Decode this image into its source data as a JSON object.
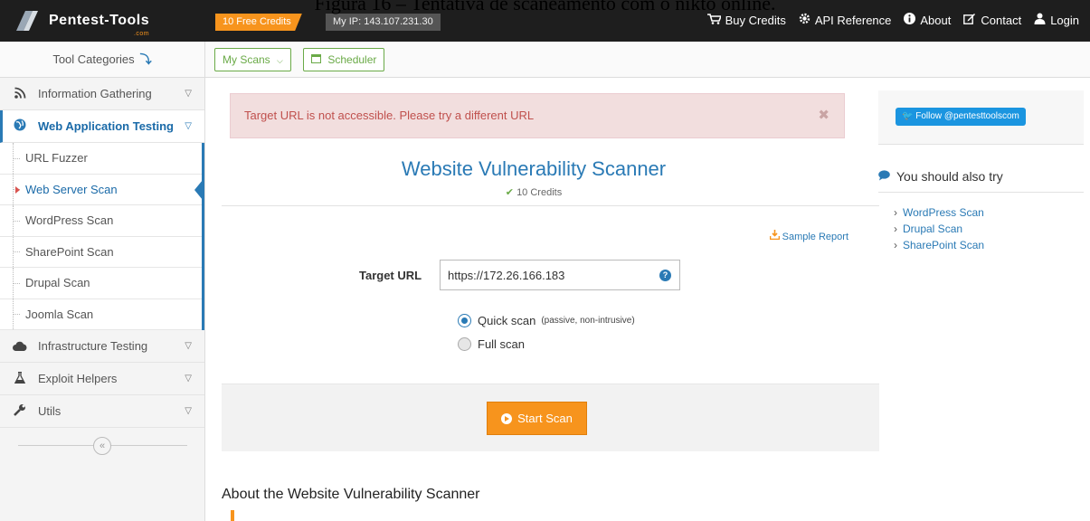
{
  "caption": "Figura 16 – Tentativa de scaneamento com o nikto online.",
  "header": {
    "logo_text": "Pentest-Tools",
    "logo_sub": ".com",
    "credits": "10 Free Credits",
    "my_ip": "My IP: 143.107.231.30",
    "nav": [
      {
        "icon": "cart-icon",
        "label": "Buy Credits"
      },
      {
        "icon": "gear-icon",
        "label": "API Reference"
      },
      {
        "icon": "info-icon",
        "label": "About"
      },
      {
        "icon": "edit-icon",
        "label": "Contact"
      },
      {
        "icon": "user-icon",
        "label": "Login"
      }
    ]
  },
  "toolbar": {
    "tool_categories": "Tool Categories",
    "my_scans": "My Scans",
    "scheduler": "Scheduler"
  },
  "sidebar": {
    "categories": [
      {
        "icon": "rss-icon",
        "label": "Information Gathering"
      },
      {
        "icon": "globe-icon",
        "label": "Web Application Testing",
        "active": true
      },
      {
        "icon": "cloud-icon",
        "label": "Infrastructure Testing"
      },
      {
        "icon": "flask-icon",
        "label": "Exploit Helpers"
      },
      {
        "icon": "wrench-icon",
        "label": "Utils"
      }
    ],
    "sub_items": [
      "URL Fuzzer",
      "Web Server Scan",
      "WordPress Scan",
      "SharePoint Scan",
      "Drupal Scan",
      "Joomla Scan"
    ],
    "active_sub": "Web Server Scan"
  },
  "main": {
    "alert": "Target URL is not accessible. Please try a different URL",
    "title": "Website Vulnerability Scanner",
    "credits": "10 Credits",
    "sample_report": "Sample Report",
    "target_label": "Target URL",
    "target_value": "https://172.26.166.183",
    "quick_scan": "Quick scan",
    "quick_hint": "(passive, non-intrusive)",
    "full_scan": "Full scan",
    "start_scan": "Start Scan",
    "about_heading": "About the Website Vulnerability Scanner"
  },
  "right": {
    "follow": "Follow @pentesttoolscom",
    "also_try": "You should also try",
    "links": [
      "WordPress Scan",
      "Drupal Scan",
      "SharePoint Scan"
    ]
  },
  "colors": {
    "accent_blue": "#2a7ab5",
    "orange": "#f7941d",
    "green": "#6aaa47",
    "alert_bg": "#f2dede"
  }
}
